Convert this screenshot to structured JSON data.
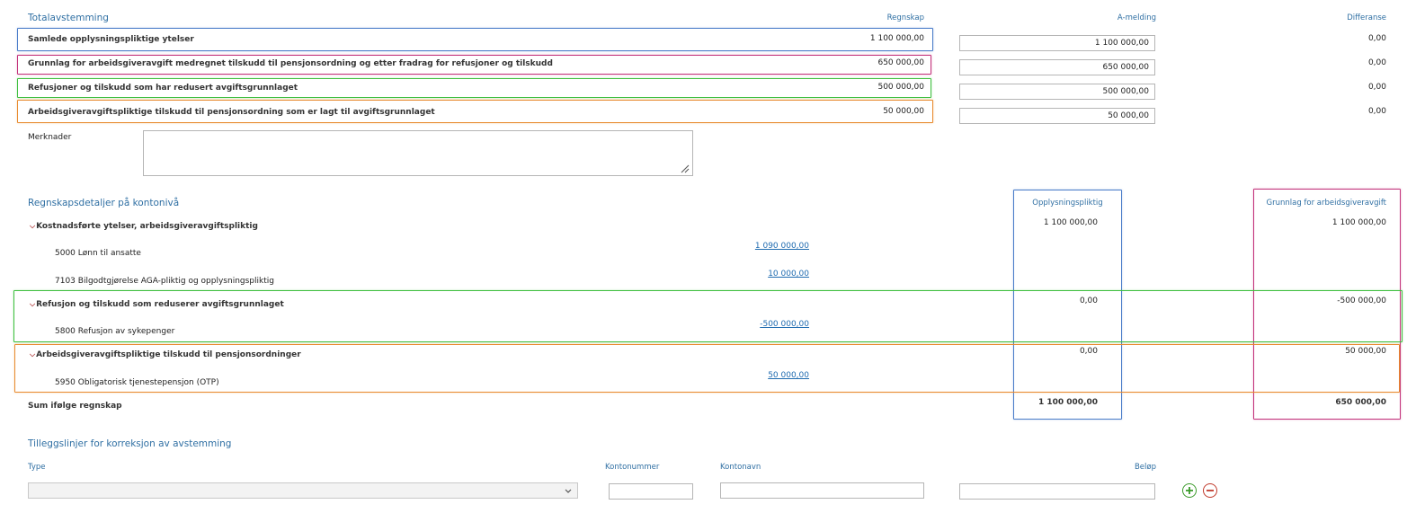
{
  "totalavstemming": {
    "title": "Totalavstemming",
    "col_regnskap": "Regnskap",
    "col_amelding": "A-melding",
    "col_differanse": "Differanse",
    "rows": [
      {
        "label": "Samlede opplysningspliktige ytelser",
        "regnskap": "1 100 000,00",
        "amelding": "1 100 000,00",
        "differanse": "0,00",
        "highlight": "#4a7cc9"
      },
      {
        "label": "Grunnlag for arbeidsgiveravgift medregnet tilskudd til pensjonsordning og etter fradrag for refusjoner og tilskudd",
        "regnskap": "650 000,00",
        "amelding": "650 000,00",
        "differanse": "0,00",
        "highlight": "#c2317a"
      },
      {
        "label": "Refusjoner og tilskudd som har redusert avgiftsgrunnlaget",
        "regnskap": "500 000,00",
        "amelding": "500 000,00",
        "differanse": "0,00",
        "highlight": "#3fbf3f"
      },
      {
        "label": "Arbeidsgiveravgiftspliktige tilskudd til pensjonsordning som er lagt til avgiftsgrunnlaget",
        "regnskap": "50 000,00",
        "amelding": "50 000,00",
        "differanse": "0,00",
        "highlight": "#e88a2e"
      }
    ],
    "merknader_label": "Merknader",
    "merknader_value": ""
  },
  "regnskapsdetaljer": {
    "title": "Regnskapsdetaljer på kontonivå",
    "col_opplysningspliktig": "Opplysningspliktig",
    "col_grunnlag": "Grunnlag for arbeidsgiveravgift",
    "groups": [
      {
        "label": "Kostnadsførte ytelser, arbeidsgiveravgiftspliktig",
        "opplysningspliktig": "1 100 000,00",
        "grunnlag": "1 100 000,00",
        "accounts": [
          {
            "label": "5000 Lønn til ansatte",
            "amount": "1 090 000,00"
          },
          {
            "label": "7103 Bilgodtgjørelse AGA-pliktig og opplysningspliktig",
            "amount": "10 000,00"
          }
        ]
      },
      {
        "label": "Refusjon og tilskudd som reduserer avgiftsgrunnlaget",
        "opplysningspliktig": "0,00",
        "grunnlag": "-500 000,00",
        "accounts": [
          {
            "label": "5800 Refusjon av sykepenger",
            "amount": "-500 000,00"
          }
        ]
      },
      {
        "label": "Arbeidsgiveravgiftspliktige tilskudd til pensjonsordninger",
        "opplysningspliktig": "0,00",
        "grunnlag": "50 000,00",
        "accounts": [
          {
            "label": "5950 Obligatorisk tjenestepensjon (OTP)",
            "amount": "50 000,00"
          }
        ]
      }
    ],
    "sum_label": "Sum ifølge regnskap",
    "sum_opplysningspliktig": "1 100 000,00",
    "sum_grunnlag": "650 000,00"
  },
  "tilleggslinjer": {
    "title": "Tilleggslinjer for korreksjon av avstemming",
    "col_type": "Type",
    "col_kontonummer": "Kontonummer",
    "col_kontonavn": "Kontonavn",
    "col_belop": "Beløp",
    "type_value": "",
    "kontonummer_value": "",
    "kontonavn_value": "",
    "belop_value": "",
    "add_icon": "plus-circle-icon",
    "remove_icon": "minus-circle-icon"
  },
  "colors": {
    "blue_highlight": "#4a7cc9",
    "magenta_highlight": "#c2317a",
    "green_highlight": "#3fbf3f",
    "orange_highlight": "#e88a2e",
    "header_text": "#2f6fa3",
    "link": "#1f6bb0",
    "add_button": "#3a9a2a",
    "remove_button": "#c0392b"
  }
}
